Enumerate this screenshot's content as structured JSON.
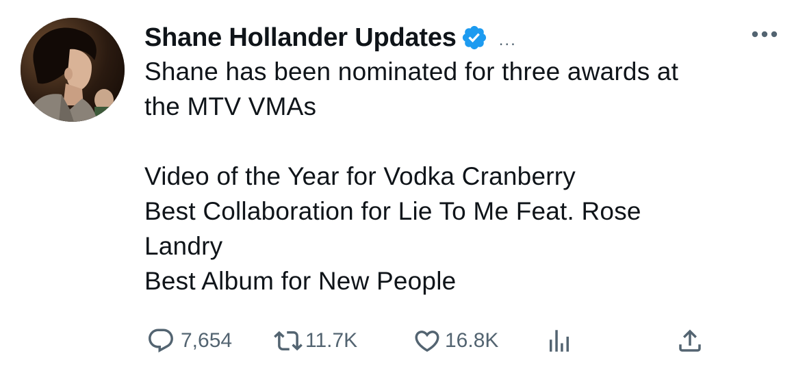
{
  "tweet": {
    "display_name": "Shane Hollander Updates",
    "header_ellipsis": "...",
    "verified_color": "#1d9bf0",
    "body_lines": [
      "Shane has been nominated for three awards at",
      "the MTV VMAs",
      "",
      "Video of the Year for Vodka Cranberry",
      "Best Collaboration for Lie To Me Feat. Rose",
      "Landry",
      "Best Album for New People"
    ]
  },
  "actions": {
    "replies": "7,654",
    "retweets": "11.7K",
    "likes": "16.8K"
  },
  "icons": {
    "avatar": "profile-photo",
    "verified": "verified-badge-icon",
    "more": "more-options-icon",
    "reply": "reply-icon",
    "retweet": "retweet-icon",
    "like": "heart-icon",
    "views": "analytics-icon",
    "share": "share-icon"
  },
  "colors": {
    "text": "#0f1419",
    "secondary": "#536471",
    "accent": "#1d9bf0"
  }
}
